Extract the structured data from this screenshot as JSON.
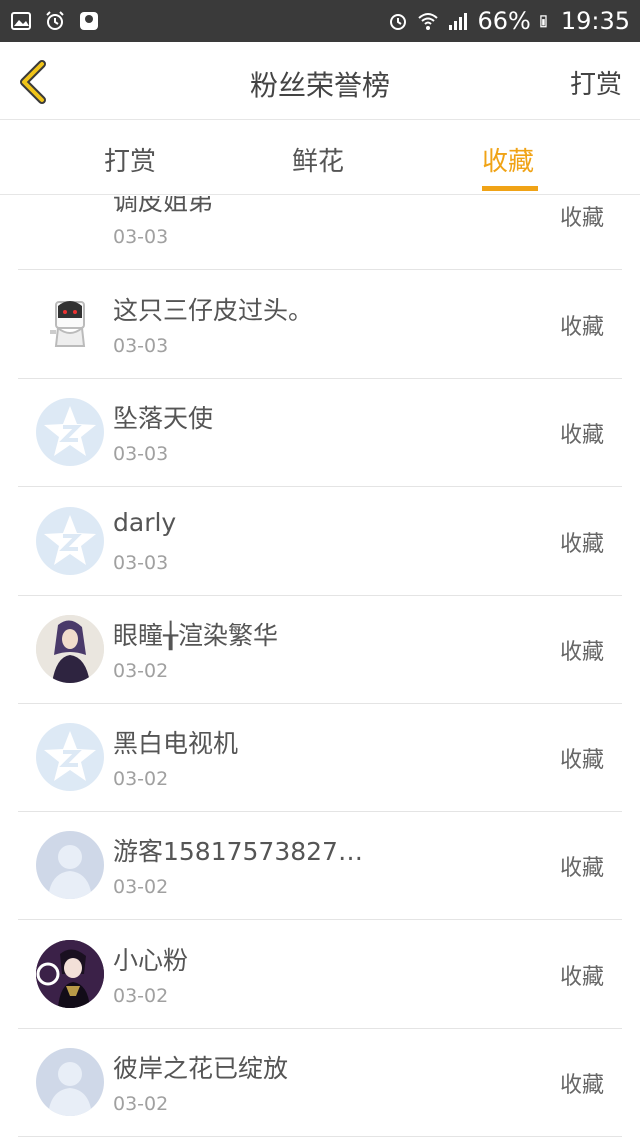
{
  "status_bar": {
    "battery": "66%",
    "time": "19:35"
  },
  "header": {
    "title": "粉丝荣誉榜",
    "right_label": "打赏"
  },
  "tabs": [
    {
      "label": "打赏",
      "active": false
    },
    {
      "label": "鲜花",
      "active": false
    },
    {
      "label": "收藏",
      "active": true
    }
  ],
  "colors": {
    "accent": "#f0a316",
    "status_bar": "#3a3a3a"
  },
  "list": [
    {
      "name": "调皮姐弟",
      "date": "03-03",
      "action": "收藏",
      "avatar": "none"
    },
    {
      "name": "这只三仔皮过头。",
      "date": "03-03",
      "action": "收藏",
      "avatar": "cartoon-icon"
    },
    {
      "name": "坠落天使",
      "date": "03-03",
      "action": "收藏",
      "avatar": "qq-star-icon"
    },
    {
      "name": "darly",
      "date": "03-03",
      "action": "收藏",
      "avatar": "qq-star-icon"
    },
    {
      "name": "眼瞳╁渲染繁华",
      "date": "03-02",
      "action": "收藏",
      "avatar": "photo-girl-icon"
    },
    {
      "name": "黑白电视机",
      "date": "03-02",
      "action": "收藏",
      "avatar": "qq-star-icon"
    },
    {
      "name": "游客15817573827…",
      "date": "03-02",
      "action": "收藏",
      "avatar": "default-user-icon"
    },
    {
      "name": "小心粉",
      "date": "03-02",
      "action": "收藏",
      "avatar": "anime-character-icon"
    },
    {
      "name": "彼岸之花已绽放",
      "date": "03-02",
      "action": "收藏",
      "avatar": "default-user-icon"
    }
  ]
}
